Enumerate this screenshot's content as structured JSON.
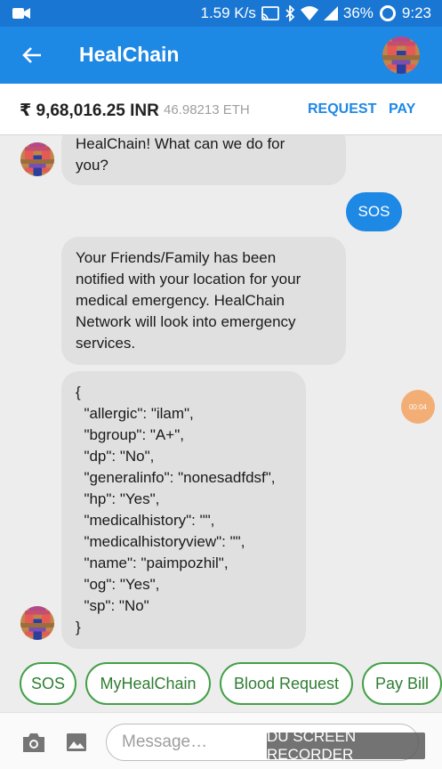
{
  "status_bar": {
    "speed": "1.59 K/s",
    "battery": "36%",
    "time": "9:23",
    "icons": [
      "video-camera-icon",
      "cast-icon",
      "bluetooth-icon",
      "wifi-icon",
      "signal-icon",
      "battery-ring-icon"
    ]
  },
  "app_bar": {
    "title": "HealChain",
    "back_icon": "arrow-left-icon"
  },
  "balance": {
    "inr": "₹ 9,68,016.25 INR",
    "separator": "·",
    "eth": "46.98213 ETH",
    "request_label": "REQUEST",
    "pay_label": "PAY"
  },
  "chat": {
    "messages": [
      {
        "from": "bot",
        "text_lines": [
          "HealChain! What can we do for",
          "you?"
        ]
      },
      {
        "from": "user",
        "text": "SOS"
      },
      {
        "from": "bot",
        "text_lines": [
          "Your Friends/Family has been",
          "notified with your location for your",
          "medical emergency. HealChain",
          "Network will look into emergency",
          "services."
        ]
      },
      {
        "from": "bot",
        "json_lines": [
          "{",
          "  \"allergic\": \"ilam\",",
          "  \"bgroup\": \"A+\",",
          "  \"dp\": \"No\",",
          "  \"generalinfo\": \"nonesadfdsf\",",
          "  \"hp\": \"Yes\",",
          "  \"medicalhistory\": \"\",",
          "  \"medicalhistoryview\": \"\",",
          "  \"name\": \"paimpozhil\",",
          "  \"og\": \"Yes\",",
          "  \"sp\": \"No\"",
          "}"
        ]
      }
    ],
    "recording_timer": "00:04"
  },
  "quick_replies": [
    "SOS",
    "MyHealChain",
    "Blood Request",
    "Pay Bill"
  ],
  "input": {
    "placeholder": "Message…",
    "value": "",
    "camera_icon": "camera-icon",
    "image_icon": "image-icon"
  },
  "watermark": "DU SCREEN RECORDER",
  "colors": {
    "status_bar": "#1976d2",
    "app_bar": "#1e88e5",
    "accent": "#1e88e5",
    "chip_border": "#43a047",
    "bot_bubble": "#e0e0e0"
  }
}
